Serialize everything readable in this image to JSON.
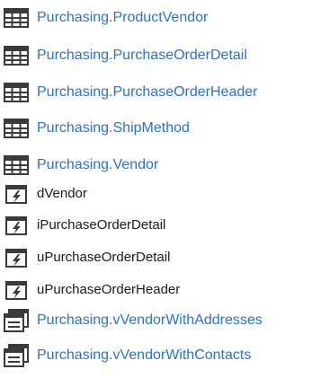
{
  "colors": {
    "link": "#2a73c9",
    "text": "#1a1a1a",
    "icon": "#3a3a3a"
  },
  "items": [
    {
      "label": "Purchasing.ProductVendor",
      "icon": "table-icon",
      "kind": "table"
    },
    {
      "label": "Purchasing.PurchaseOrderDetail",
      "icon": "table-icon",
      "kind": "table"
    },
    {
      "label": "Purchasing.PurchaseOrderHeader",
      "icon": "table-icon",
      "kind": "table"
    },
    {
      "label": "Purchasing.ShipMethod",
      "icon": "table-icon",
      "kind": "table"
    },
    {
      "label": "Purchasing.Vendor",
      "icon": "table-icon",
      "kind": "table"
    },
    {
      "label": "dVendor",
      "icon": "trigger-icon",
      "kind": "trigger"
    },
    {
      "label": "iPurchaseOrderDetail",
      "icon": "trigger-icon",
      "kind": "trigger"
    },
    {
      "label": "uPurchaseOrderDetail",
      "icon": "trigger-icon",
      "kind": "trigger"
    },
    {
      "label": "uPurchaseOrderHeader",
      "icon": "trigger-icon",
      "kind": "trigger"
    },
    {
      "label": "Purchasing.vVendorWithAddresses",
      "icon": "view-icon",
      "kind": "view"
    },
    {
      "label": "Purchasing.vVendorWithContacts",
      "icon": "view-icon",
      "kind": "view"
    }
  ]
}
